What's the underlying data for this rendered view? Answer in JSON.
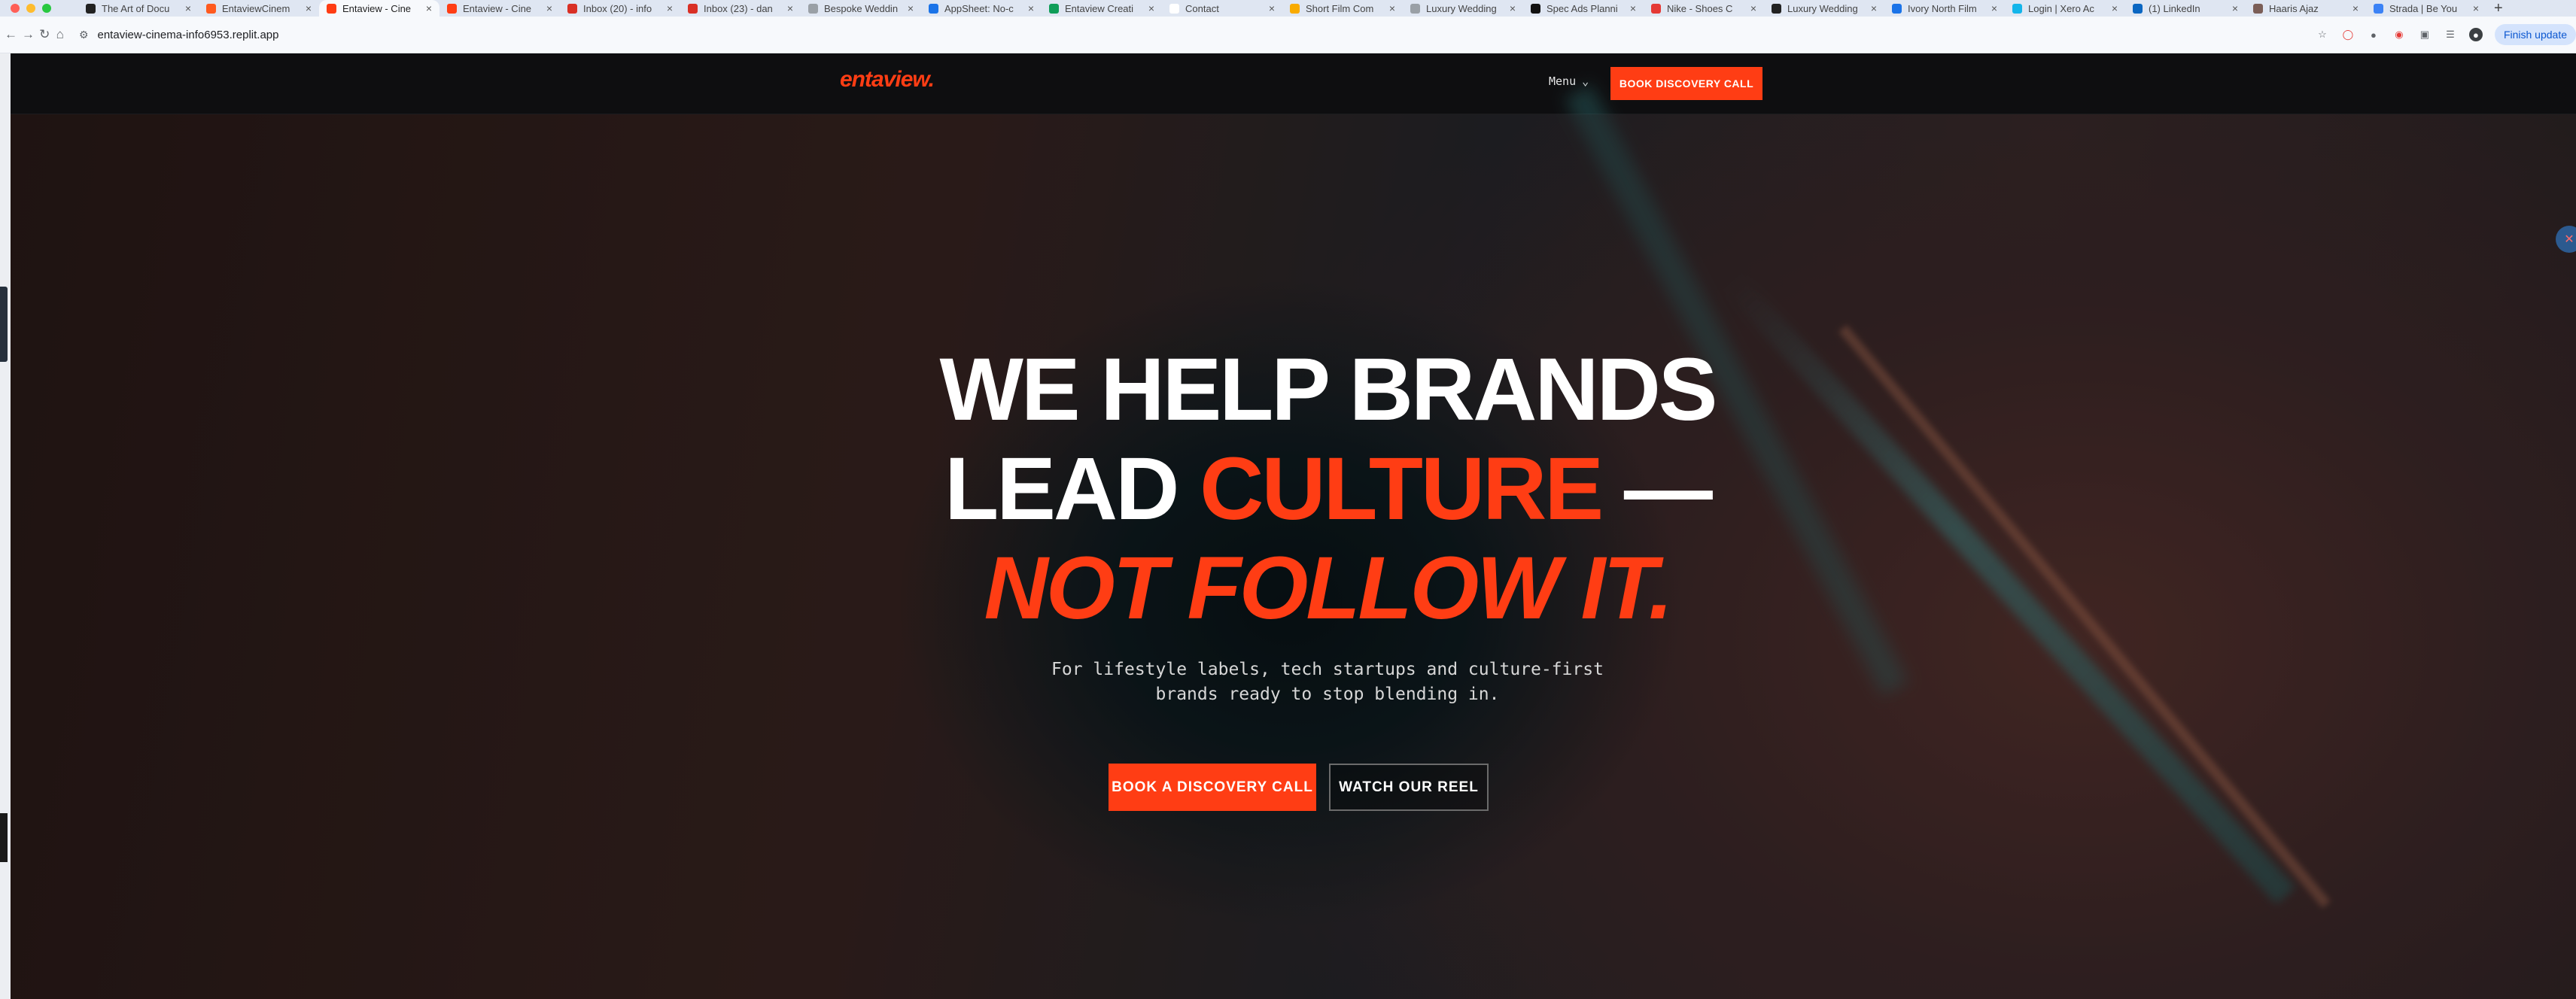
{
  "browser": {
    "tabs": [
      {
        "title": "The Art of Docu",
        "fav": "#222"
      },
      {
        "title": "EntaviewCinem",
        "fav": "#ff5a1f"
      },
      {
        "title": "Entaview - Cine",
        "fav": "#ff3d14",
        "active": true
      },
      {
        "title": "Entaview - Cine",
        "fav": "#ff3d14"
      },
      {
        "title": "Inbox (20) - info",
        "fav": "#d93025"
      },
      {
        "title": "Inbox (23) - dan",
        "fav": "#d93025"
      },
      {
        "title": "Bespoke Weddin",
        "fav": "#9aa0a6"
      },
      {
        "title": "AppSheet: No-c",
        "fav": "#1a73e8"
      },
      {
        "title": "Entaview Creati",
        "fav": "#0f9d58"
      },
      {
        "title": "Contact",
        "fav": "#ffffff"
      },
      {
        "title": "Short Film Com",
        "fav": "#f9ab00"
      },
      {
        "title": "Luxury Wedding",
        "fav": "#9aa0a6"
      },
      {
        "title": "Spec Ads Planni",
        "fav": "#111"
      },
      {
        "title": "Nike - Shoes C",
        "fav": "#e53935"
      },
      {
        "title": "Luxury Wedding",
        "fav": "#222"
      },
      {
        "title": "Ivory North Film",
        "fav": "#1a73e8"
      },
      {
        "title": "Login | Xero Ac",
        "fav": "#13b5ea"
      },
      {
        "title": "(1) LinkedIn",
        "fav": "#0a66c2"
      },
      {
        "title": "Haaris Ajaz",
        "fav": "#7b5e57"
      },
      {
        "title": "Strada | Be You",
        "fav": "#3b82f6"
      }
    ],
    "new_tab_symbol": "+",
    "url": "entaview-cinema-info6953.replit.app",
    "finish_update": "Finish update"
  },
  "site": {
    "logo": "entaview.",
    "menu_label": "Menu",
    "menu_chevron": "⌄",
    "nav_cta": "BOOK DISCOVERY CALL",
    "hero": {
      "line1": "WE HELP BRANDS",
      "line2_a": "LEAD ",
      "line2_b": "CULTURE",
      "line2_c": " —",
      "line3": "NOT FOLLOW IT.",
      "subtitle": "For lifestyle labels, tech startups and culture-first brands ready to stop blending in.",
      "primary_button": "BOOK A DISCOVERY CALL",
      "secondary_button": "WATCH OUR REEL"
    }
  },
  "colors": {
    "accent": "#ff3d14",
    "nav_bg": "#0e0e10",
    "text": "#ffffff"
  }
}
